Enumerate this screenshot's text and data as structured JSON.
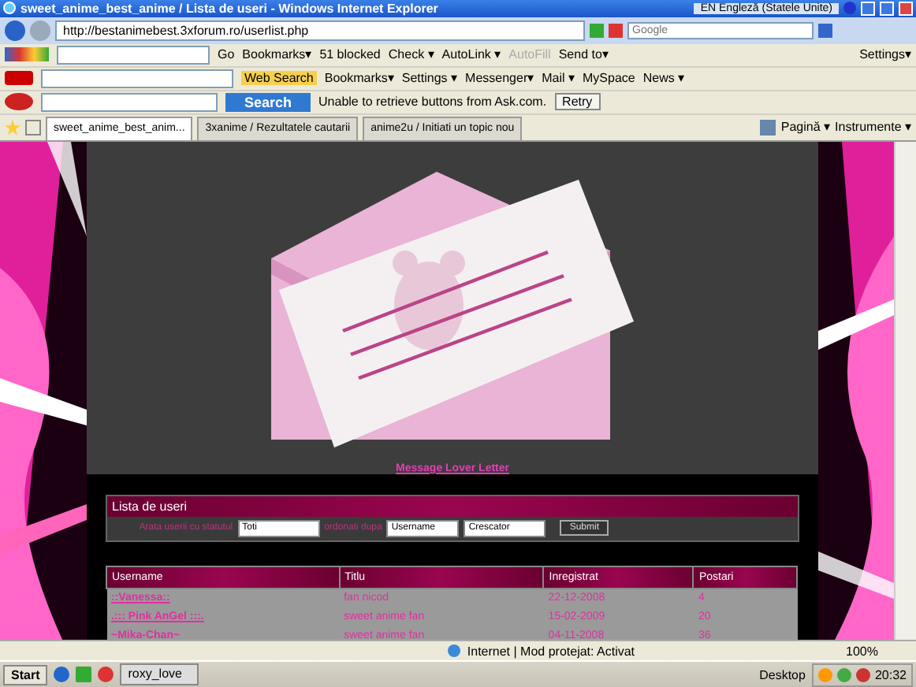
{
  "window": {
    "title": "sweet_anime_best_anime / Lista de useri - Windows Internet Explorer",
    "language": "EN Engleză (Statele Unite)"
  },
  "address_bar": {
    "url": "http://bestanimebest.3xforum.ro/userlist.php",
    "search_placeholder": "Google"
  },
  "google_toolbar": {
    "go": "Go",
    "items": [
      {
        "label": "Bookmarks▾",
        "disabled": false
      },
      {
        "label": "51 blocked",
        "disabled": false
      },
      {
        "label": "Check ▾",
        "disabled": false
      },
      {
        "label": "AutoLink ▾",
        "disabled": false
      },
      {
        "label": "AutoFill",
        "disabled": true
      },
      {
        "label": "Send to▾",
        "disabled": false
      }
    ],
    "settings": "Settings▾"
  },
  "yahoo_toolbar": {
    "search": "Web Search",
    "items": [
      "Bookmarks▾",
      "Settings ▾",
      "Messenger▾",
      "Mail ▾",
      "MySpace",
      "News ▾"
    ]
  },
  "ask_toolbar": {
    "search": "Search",
    "message": "Unable to retrieve buttons from Ask.com.",
    "retry": "Retry"
  },
  "tabs": [
    {
      "label": "sweet_anime_best_anim...",
      "selected": true
    },
    {
      "label": "3xanime / Rezultatele cautarii",
      "selected": false
    },
    {
      "label": "anime2u / Initiati un topic nou",
      "selected": false
    }
  ],
  "command_bar": [
    "Pagină ▾",
    "Instrumente ▾"
  ],
  "page": {
    "picture_link": "Message Lover Letter",
    "panel_title": "Lista de useri",
    "filter": {
      "label": "Arata userii cu statutul",
      "status": "Toti",
      "order_label": "ordonati dupa",
      "order_by": "Username",
      "direction": "Crescator",
      "submit": "Submit"
    },
    "table": {
      "columns": [
        "Username",
        "Titlu",
        "Inregistrat",
        "Postari"
      ],
      "rows": [
        [
          "::Vanessa::",
          "fan nicod",
          "22-12-2008",
          "4"
        ],
        [
          ".::: Pink AnGel :::.",
          "sweet anime fan",
          "15-02-2009",
          "20"
        ],
        [
          "~Mika-Chan~",
          "sweet anime fan",
          "04-11-2008",
          "36"
        ]
      ]
    }
  },
  "status_bar": {
    "zone": "Internet | Mod protejat: Activat",
    "zoom": "100%"
  },
  "taskbar": {
    "start": "Start",
    "tasks": [
      "roxy_love"
    ],
    "desktop": "Desktop",
    "clock": "20:32"
  }
}
